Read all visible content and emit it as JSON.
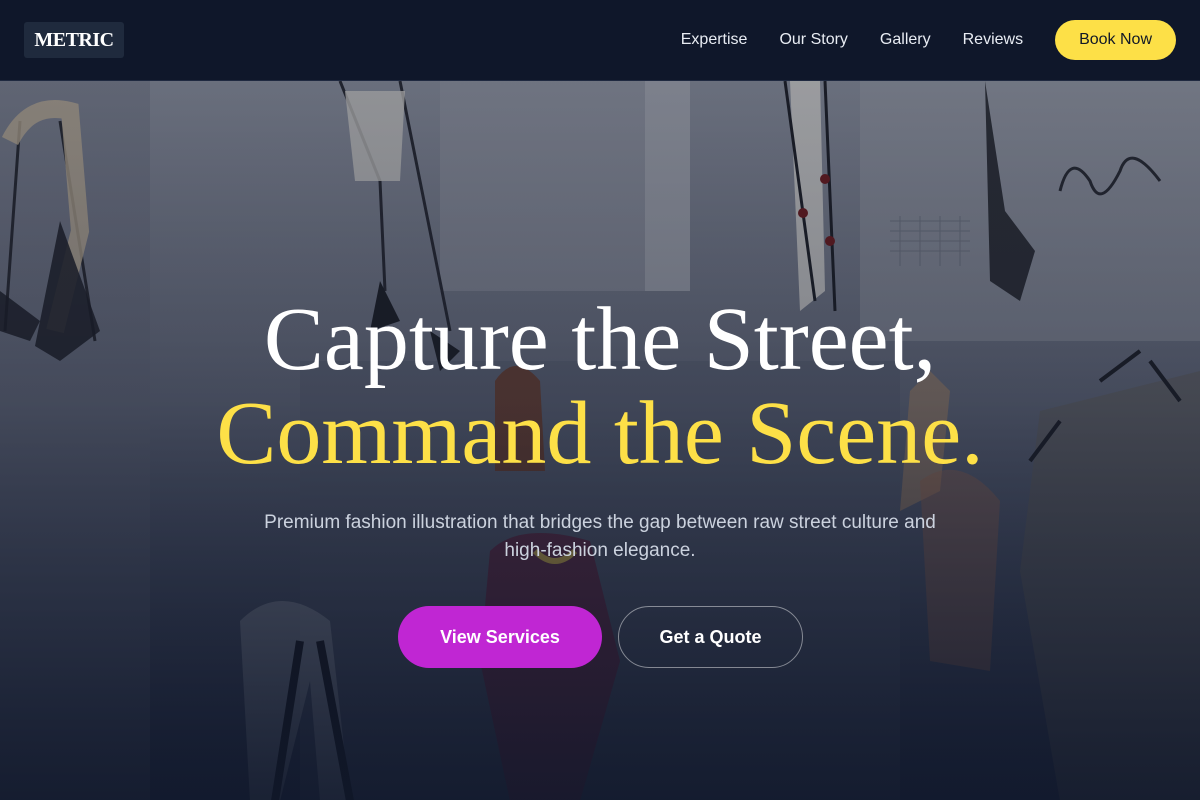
{
  "header": {
    "logo_text": "METRIC",
    "nav": [
      {
        "label": "Expertise"
      },
      {
        "label": "Our Story"
      },
      {
        "label": "Gallery"
      },
      {
        "label": "Reviews"
      }
    ],
    "cta_label": "Book Now"
  },
  "hero": {
    "headline_line1": "Capture the Street,",
    "headline_line2": "Command the Scene.",
    "subtext": "Premium fashion illustration that bridges the gap between raw street culture and high-fashion elegance.",
    "primary_button": "View Services",
    "secondary_button": "Get a Quote",
    "background_image": "fashion-sketches-background"
  },
  "colors": {
    "navy": "#0f172a",
    "accent_yellow": "#fde047",
    "primary_magenta": "#c026d3"
  }
}
